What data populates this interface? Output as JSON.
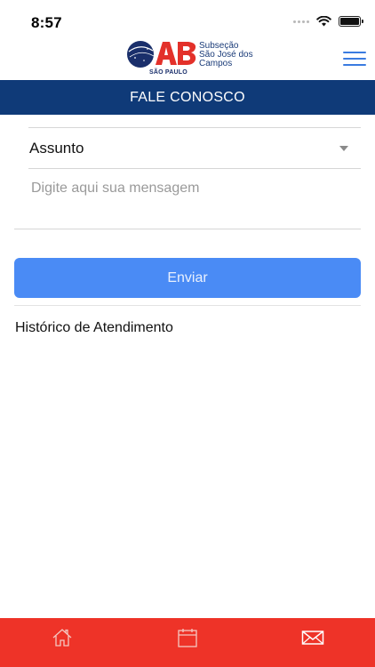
{
  "status_bar": {
    "time": "8:57"
  },
  "header": {
    "logo_letters": "OAB",
    "logo_region": "SÃO PAULO",
    "logo_lines": [
      "Subseção",
      "São José dos",
      "Campos"
    ]
  },
  "title_bar": {
    "title": "FALE CONOSCO"
  },
  "form": {
    "subject_value": "Assunto",
    "message_placeholder": "Digite aqui sua mensagem",
    "message_value": "",
    "send_label": "Enviar"
  },
  "history": {
    "title": "Histórico de Atendimento"
  },
  "tab_bar": {
    "tabs": [
      {
        "icon": "home-icon"
      },
      {
        "icon": "calendar-icon"
      },
      {
        "icon": "mail-icon"
      }
    ]
  },
  "colors": {
    "title_bar": "#0f3a78",
    "send_button": "#4a8bf5",
    "tab_bar": "#ee3328",
    "menu": "#3a7be0"
  }
}
